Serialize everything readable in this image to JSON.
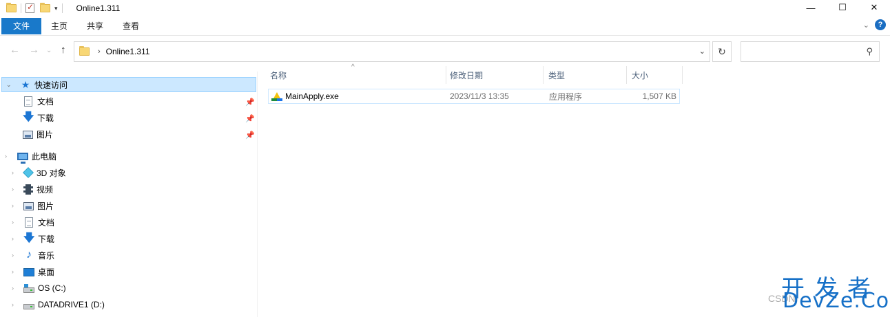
{
  "window": {
    "title": "Online1.311",
    "controls": {
      "minimize": "—",
      "maximize": "☐",
      "close": "✕"
    }
  },
  "qat": {
    "dropdown_glyph": "▾"
  },
  "ribbon": {
    "tabs": [
      {
        "label": "文件",
        "active": true
      },
      {
        "label": "主页"
      },
      {
        "label": "共享"
      },
      {
        "label": "查看"
      }
    ],
    "expand_glyph": "⌄",
    "help_glyph": "?"
  },
  "navigation": {
    "back_glyph": "←",
    "forward_glyph": "→",
    "recent_glyph": "⌄",
    "up_glyph": "↑"
  },
  "address": {
    "separator": "›",
    "crumb": "Online1.311",
    "dropdown_glyph": "⌄",
    "refresh_glyph": "↻"
  },
  "search": {
    "placeholder": "",
    "icon_glyph": "⚲"
  },
  "tree": {
    "quick_access": {
      "label": "快速访问",
      "items": [
        {
          "label": "文档",
          "icon": "document-icon",
          "pinned": true
        },
        {
          "label": "下载",
          "icon": "download-icon",
          "pinned": true
        },
        {
          "label": "图片",
          "icon": "picture-icon",
          "pinned": true
        }
      ]
    },
    "this_pc": {
      "label": "此电脑",
      "items": [
        {
          "label": "3D 对象",
          "icon": "3d-objects-icon"
        },
        {
          "label": "视频",
          "icon": "video-icon"
        },
        {
          "label": "图片",
          "icon": "picture-icon"
        },
        {
          "label": "文档",
          "icon": "document-icon"
        },
        {
          "label": "下载",
          "icon": "download-icon"
        },
        {
          "label": "音乐",
          "icon": "music-icon"
        },
        {
          "label": "桌面",
          "icon": "desktop-icon"
        },
        {
          "label": "OS (C:)",
          "icon": "os-drive-icon"
        },
        {
          "label": "DATADRIVE1 (D:)",
          "icon": "drive-icon"
        }
      ]
    },
    "pin_glyph": "📌",
    "expanded_glyph": "⌄",
    "collapsed_glyph": "›"
  },
  "columns": {
    "name": "名称",
    "date": "修改日期",
    "type": "类型",
    "size": "大小",
    "sort_glyph": "^"
  },
  "files": [
    {
      "name": "MainApply.exe",
      "date": "2023/11/3 13:35",
      "type": "应用程序",
      "size": "1,507 KB"
    }
  ],
  "watermark": {
    "cn": "开发者",
    "en": "CSDN",
    "site": "DevZe.CoM"
  }
}
